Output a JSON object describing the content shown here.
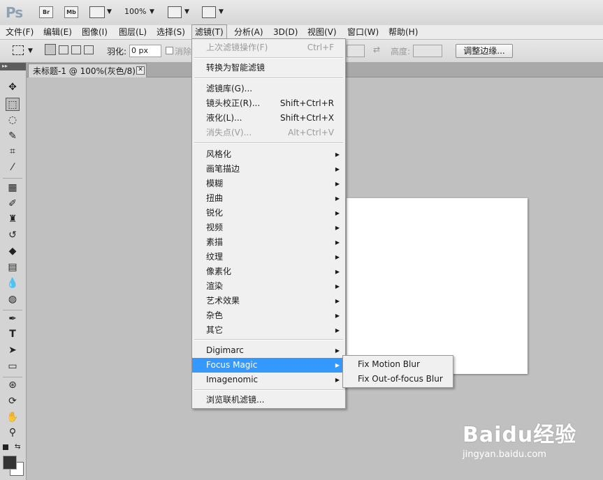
{
  "appbar": {
    "logo": "Ps",
    "br": "Br",
    "mb": "Mb",
    "zoom": "100%"
  },
  "menubar": {
    "items": [
      "文件(F)",
      "编辑(E)",
      "图像(I)",
      "图层(L)",
      "选择(S)",
      "滤镜(T)",
      "分析(A)",
      "3D(D)",
      "视图(V)",
      "窗口(W)",
      "帮助(H)"
    ]
  },
  "options": {
    "feather_label": "羽化:",
    "feather_value": "0 px",
    "antialias_label": "消除",
    "height_label": "高度:",
    "refine_edge": "调整边缘..."
  },
  "document": {
    "tab_title": "未标题-1 @ 100%(灰色/8)",
    "close": "✕"
  },
  "filter_menu": {
    "last_filter": {
      "label": "上次滤镜操作(F)",
      "shortcut": "Ctrl+F"
    },
    "smart": "转换为智能滤镜",
    "gallery": "滤镜库(G)...",
    "lens": {
      "label": "镜头校正(R)...",
      "shortcut": "Shift+Ctrl+R"
    },
    "liquify": {
      "label": "液化(L)...",
      "shortcut": "Shift+Ctrl+X"
    },
    "vanishing": {
      "label": "消失点(V)...",
      "shortcut": "Alt+Ctrl+V"
    },
    "groups": [
      "风格化",
      "画笔描边",
      "模糊",
      "扭曲",
      "锐化",
      "视频",
      "素描",
      "纹理",
      "像素化",
      "渲染",
      "艺术效果",
      "杂色",
      "其它"
    ],
    "plugins": [
      "Digimarc",
      "Focus Magic",
      "Imagenomic"
    ],
    "browse": "浏览联机滤镜..."
  },
  "submenu": {
    "items": [
      "Fix Motion Blur",
      "Fix Out-of-focus Blur"
    ]
  },
  "watermark": {
    "brand": "Baidu经验",
    "url": "jingyan.baidu.com"
  }
}
